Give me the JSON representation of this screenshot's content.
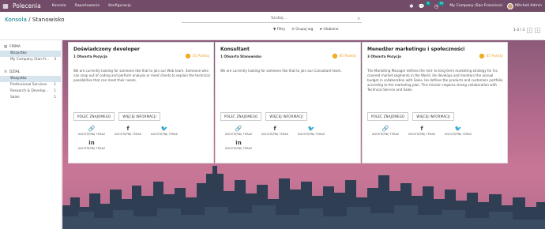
{
  "navbar": {
    "apps_icon": "grid-icon",
    "brand": "Polecenia",
    "menu": [
      "Konsola",
      "Raportowanie",
      "Konfiguracja"
    ],
    "discuss_badge": "5",
    "activity_badge": "74",
    "company": "My Company (San Francisco)",
    "user": "Mitchell Admin"
  },
  "breadcrumb": {
    "parent": "Konsola",
    "separator": "/",
    "current": "Stanowisko"
  },
  "search": {
    "placeholder": "Szukaj..."
  },
  "filters": {
    "filters_label": "Filtry",
    "groupby_label": "Grupuj wg",
    "favorites_label": "Ulubione"
  },
  "pager": {
    "value": "1-3 / 3"
  },
  "sidebar": {
    "sections": [
      {
        "title": "FIRMA",
        "items": [
          {
            "label": "Wszystko",
            "count": "",
            "active": true
          },
          {
            "label": "My Company (San Fr...",
            "count": "3",
            "active": false
          }
        ]
      },
      {
        "title": "DZIAŁ",
        "items": [
          {
            "label": "Wszystko",
            "count": "",
            "active": true
          },
          {
            "label": "Professional Services",
            "count": "1",
            "active": false
          },
          {
            "label": "Research & Develop...",
            "count": "1",
            "active": false
          },
          {
            "label": "Sales",
            "count": "1",
            "active": false
          }
        ]
      }
    ]
  },
  "cards": [
    {
      "title": "Doświadczony developer",
      "positions": "1 Otwarta Pozycja",
      "points": "35 Punkty",
      "description": "We are currently looking for someone like that to join our Web team. Someone who can snap out of coding and perform analysis or meet clients to explain the technical possibilities that can meet their needs."
    },
    {
      "title": "Konsultant",
      "positions": "1 Otwarta Stanowisko",
      "points": "85 Punkty",
      "description": "We are currently looking for someone like that to join our Consultant team."
    },
    {
      "title": "Menedżer marketingu i społeczności",
      "positions": "3 Otwarta Pozycja",
      "points": "05 Punkty",
      "description": "The Marketing Manager defines the mid- to long-term marketing strategy for his covered market segments in the World. He develops and monitors the annual budget in collaboration with Sales. He defines the products and customers portfolio according to the marketing plan. This mission requires strong collaboration with Technical Service and Sales."
    }
  ],
  "card_actions": {
    "refer": "POLEĆ ZNAJOMEGO",
    "more": "WIĘCEJ INFORMACJI"
  },
  "share": {
    "link": {
      "icon": "link-icon",
      "label": "UDOSTĘPNIJ TERAZ"
    },
    "facebook": {
      "icon": "facebook-icon",
      "label": "UDOSTĘPNIJ TERAZ"
    },
    "twitter": {
      "icon": "twitter-icon",
      "label": "UDOSTĘPNIJ TERAZ"
    },
    "linkedin": {
      "icon": "linkedin-icon",
      "label": "UDOSTĘPNIJ TERAZ"
    }
  },
  "colors": {
    "navbar": "#714b67",
    "accent": "#017e84",
    "active_filter": "#d6e4ee",
    "points": "#f3b31a"
  }
}
